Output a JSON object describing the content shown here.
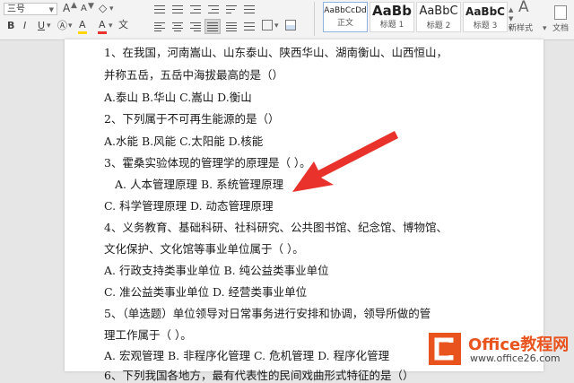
{
  "toolbar": {
    "font_size": "三号",
    "grow_font": "A",
    "shrink_font": "A",
    "bold": "B",
    "italic": "I",
    "underline": "U",
    "font_color": "A",
    "highlight": "A",
    "wenzi": "文",
    "new_style": "新样式",
    "doc_assist": "文档"
  },
  "styles": [
    {
      "sample": "AaBbCcDd",
      "name": "正文"
    },
    {
      "sample": "AaBb",
      "name": "标题 1"
    },
    {
      "sample": "AaBbC",
      "name": "标题 2"
    },
    {
      "sample": "AaBbC",
      "name": "标题 3"
    }
  ],
  "document": {
    "lines": [
      "1、在我国，河南嵩山、山东泰山、陕西华山、湖南衡山、山西恒山，",
      "并称五岳，五岳中海拔最高的是（）",
      "A.泰山 B.华山 C.嵩山 D.衡山",
      "2、下列属于不可再生能源的是（）",
      "A.水能 B.风能 C.太阳能 D.核能",
      "3、霍桑实验体现的管理学的原理是（ ）。",
      "A. 人本管理原理 B. 系统管理原理",
      "C. 科学管理原理 D. 动态管理原理",
      "4、义务教育、基础科研、社科研究、公共图书馆、纪念馆、博物馆、",
      "文化保护、文化馆等事业单位属于（ ）。",
      "A. 行政支持类事业单位 B. 纯公益类事业单位",
      "C. 准公益类事业单位 D. 经营类事业单位",
      "5、（单选题）单位领导对日常事务进行安排和协调，领导所做的管",
      "理工作属于（ ）。",
      "A. 宏观管理 B. 非程序化管理 C. 危机管理 D. 程序化管理",
      "6、下列我国各地方，最有代表性的民间戏曲形式特征的是（）"
    ]
  },
  "watermark": {
    "brand": "Office教程网",
    "url": "www.office26.com"
  },
  "colors": {
    "arrow": "#e8322b",
    "logo": "#e9531d",
    "font_color_bar": "#e8322b",
    "highlight_bar": "#ffd700"
  }
}
